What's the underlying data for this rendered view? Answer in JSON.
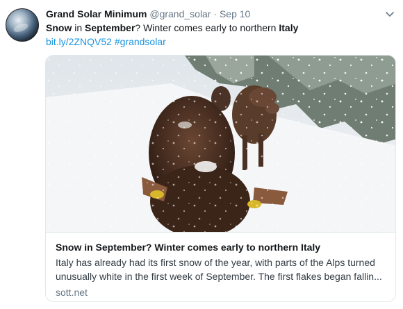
{
  "tweet": {
    "author_name": "Grand Solar Minimum",
    "handle": "@grand_solar",
    "separator": "·",
    "date": "Sep 10",
    "text": {
      "word1": "Snow",
      "word2": " in ",
      "word3": "September",
      "word4": "? Winter comes early to northern ",
      "word5": "Italy"
    },
    "short_link": "bit.ly/2ZNQV52",
    "hashtag": "#grandsolar"
  },
  "card": {
    "title": "Snow in September? Winter comes early to northern Italy",
    "description": "Italy has already had its first snow of the year, with parts of the Alps turned unusually white in the first week of September. The first flakes began fallin...",
    "domain": "sott.net"
  },
  "icons": {
    "caret": "chevron-down-icon",
    "avatar": "profile-avatar"
  },
  "colors": {
    "link": "#1b95e0",
    "secondary_text": "#657786",
    "border": "#e1e8ed"
  }
}
